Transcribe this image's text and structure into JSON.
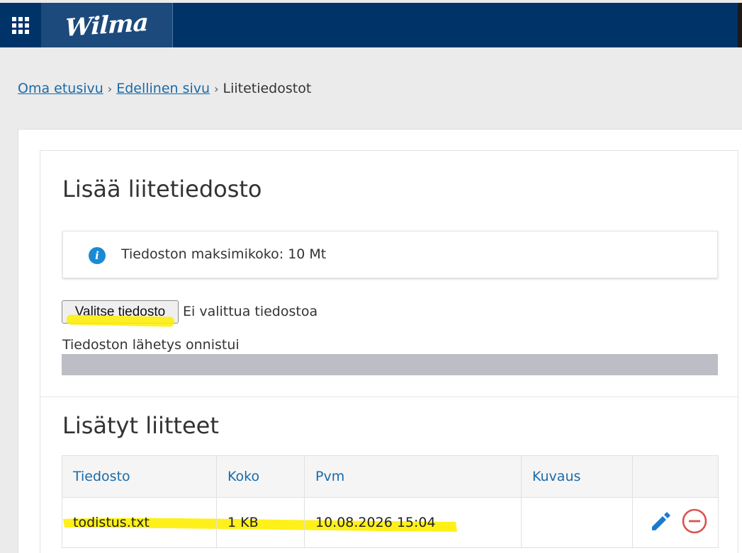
{
  "header": {
    "apps_menu_icon": "grid-icon",
    "logo_text": "Wilma",
    "brand_color": "#003468"
  },
  "breadcrumb": {
    "home": "Oma etusivu",
    "previous": "Edellinen sivu",
    "current": "Liitetiedostot"
  },
  "add_section": {
    "title": "Lisää liitetiedosto",
    "info_icon": "info-icon",
    "info_text": "Tiedoston maksimikoko: 10 Mt",
    "choose_button": "Valitse tiedosto",
    "no_file_text": "Ei valittua tiedostoa",
    "upload_status": "Tiedoston lähetys onnistui",
    "progress_fraction": 1.0
  },
  "list_section": {
    "title": "Lisätyt liitteet",
    "columns": [
      "Tiedosto",
      "Koko",
      "Pvm",
      "Kuvaus",
      ""
    ],
    "rows": [
      {
        "file": "todistus.txt",
        "size": "1 KB",
        "date": "10.08.2026 15:04",
        "description": "",
        "edit_icon": "pencil-icon",
        "delete_icon": "remove-circle-icon"
      }
    ]
  },
  "colors": {
    "link": "#1a6aa8",
    "highlight": "#ffee00",
    "delete": "#d9534f",
    "edit": "#1a7ad0"
  }
}
